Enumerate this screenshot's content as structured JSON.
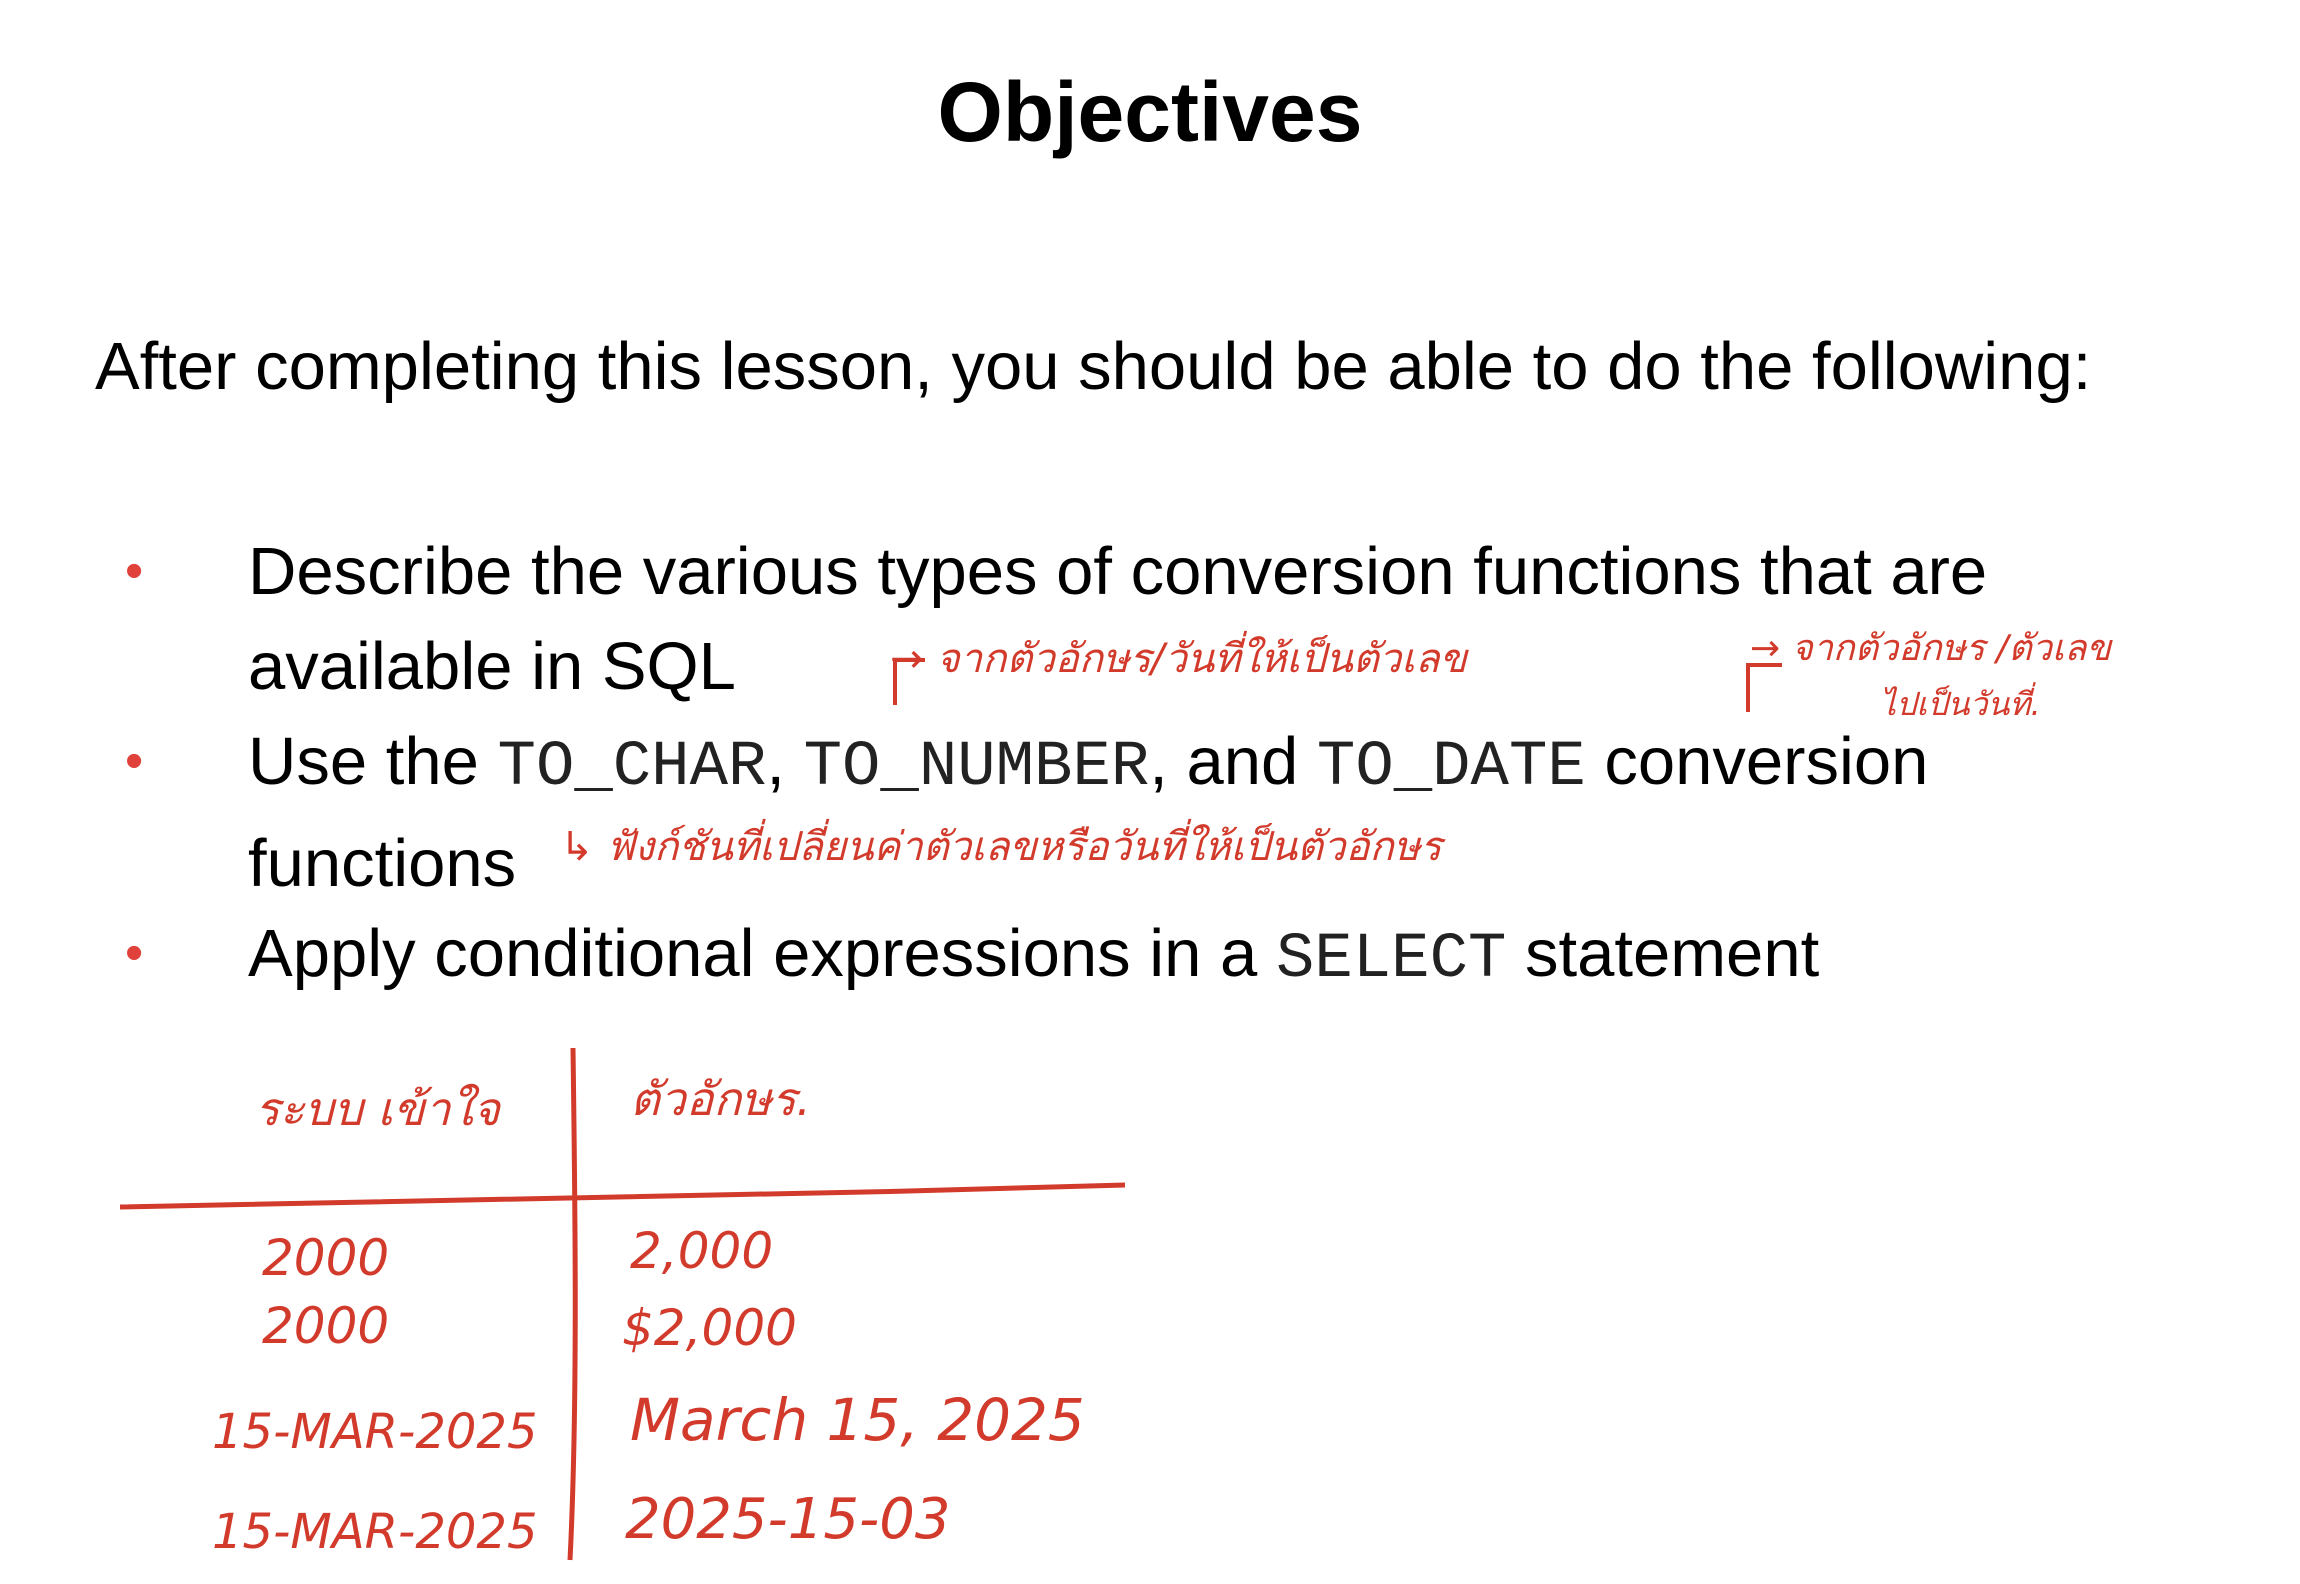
{
  "title": "Objectives",
  "intro": "After completing this lesson, you should be able to do the following:",
  "bullet_char": "•",
  "bullets": [
    {
      "line1": "Describe the various types of conversion functions that are",
      "line2": "available in SQL"
    },
    {
      "part1": "Use the ",
      "code1": "TO_CHAR",
      "sep1": ", ",
      "code2": "TO_NUMBER",
      "sep2": ", and ",
      "code3": "TO_DATE",
      "part2": " conversion",
      "line2": "functions"
    },
    {
      "part1": "Apply conditional expressions in a ",
      "code1": "SELECT",
      "part2": " statement"
    }
  ],
  "handwriting": {
    "note_1": "→ จากตัวอักษร/วันที่ให้เป็นตัวเลข",
    "note_2a": "→ จากตัวอักษร /ตัวเลข",
    "note_2b": "ไปเป็นวันที่.",
    "note_3": "↳ ฟังก์ชันที่เปลี่ยนค่าตัวเลขหรือวันที่ให้เป็นตัวอักษร",
    "table": {
      "headers": [
        "ระบบ เข้าใจ",
        "ตัวอักษร."
      ],
      "rows": [
        [
          "2000",
          "2,000"
        ],
        [
          "2000",
          "$2,000"
        ],
        [
          "15-MAR-2025",
          "March 15, 2025"
        ],
        [
          "15-MAR-2025",
          "2025-15-03"
        ]
      ]
    },
    "ink_color": "#d23a2b"
  }
}
